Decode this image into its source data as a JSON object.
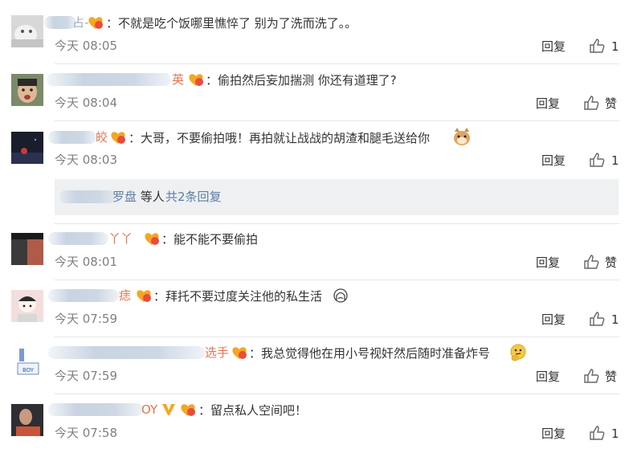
{
  "comments": [
    {
      "name_tail": "占-",
      "text": "：不就是吃个饭哪里憔悴了 别为了洗而洗了。。",
      "time": "今天 08:05",
      "reply": "回复",
      "likes": "1"
    },
    {
      "name_tail": "英",
      "text": "：偷拍然后妄加揣测 你还有道理了?",
      "time": "今天 08:04",
      "reply": "回复",
      "likes": "赞"
    },
    {
      "name_tail": "皎",
      "text": "：大哥，不要偷拍哦！再拍就让战战的胡渣和腿毛送给你",
      "time": "今天 08:03",
      "reply": "回复",
      "likes": "1"
    },
    {
      "name_tail": "丫丫",
      "text": "：能不能不要偷拍",
      "time": "今天 08:01",
      "reply": "回复",
      "likes": "赞"
    },
    {
      "name_tail": "痣",
      "text": "：拜托不要过度关注他的私生活",
      "time": "今天 07:59",
      "reply": "回复",
      "likes": "1"
    },
    {
      "name_tail": "选手",
      "text": "：我总觉得他在用小号视奸然后随时准备炸号",
      "time": "今天 07:59",
      "reply": "回复",
      "likes": "赞"
    },
    {
      "name_tail": "OY",
      "text": "：留点私人空间吧！",
      "time": "今天 07:58",
      "reply": "回复",
      "likes": "1"
    }
  ],
  "subreply": {
    "name_tail": "罗盘",
    "suffix": " 等人 ",
    "count_link": "共2条回复"
  },
  "colors": {
    "name_orange": "#eb7350",
    "link_blue": "#5d7ea8",
    "time_gray": "#808080"
  }
}
